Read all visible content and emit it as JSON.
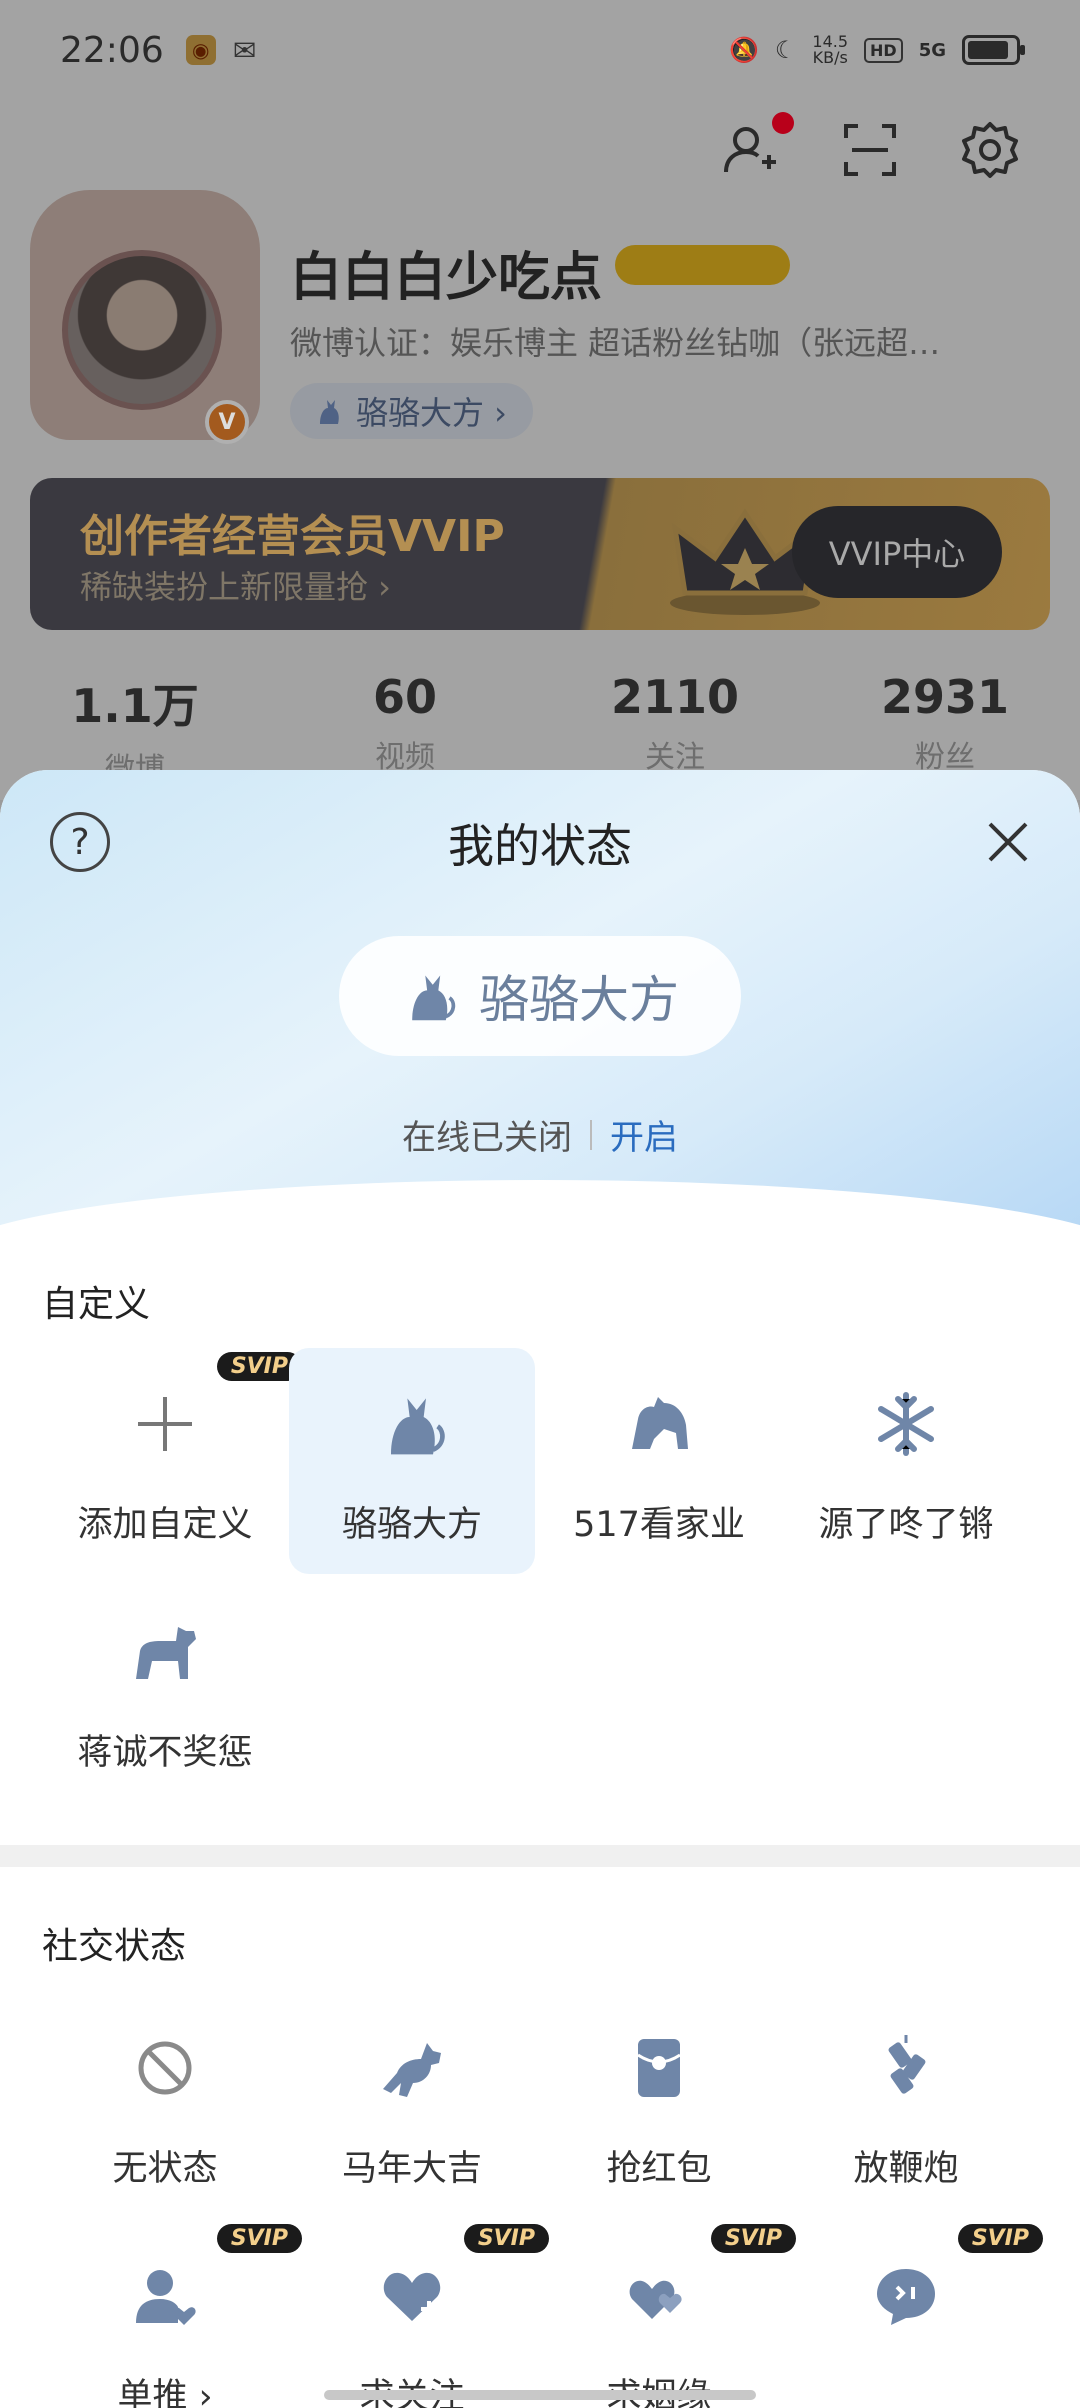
{
  "status_bar": {
    "time": "22:06",
    "net_speed": "14.5",
    "net_unit": "KB/s",
    "hd": "HD",
    "signal": "5G"
  },
  "profile": {
    "username": "白白白少吃点",
    "verification": "微博认证：娱乐博主 超话粉丝钻咖（张远超…",
    "status_chip_label": "骆骆大方 ›",
    "avatar_badge": "V"
  },
  "vvip_banner": {
    "title": "创作者经营会员VVIP",
    "subtitle": "稀缺装扮上新限量抢 ›",
    "button": "VVIP中心"
  },
  "stats": [
    {
      "value": "1.1万",
      "label": "微博"
    },
    {
      "value": "60",
      "label": "视频"
    },
    {
      "value": "2110",
      "label": "关注"
    },
    {
      "value": "2931",
      "label": "粉丝"
    }
  ],
  "sheet": {
    "help": "?",
    "title": "我的状态",
    "current_status": "骆骆大方",
    "online_text": "在线已关闭",
    "online_action": "开启"
  },
  "custom_section": {
    "title": "自定义",
    "items": [
      {
        "label": "添加自定义",
        "icon": "plus-icon",
        "badge": "SVIP"
      },
      {
        "label": "骆骆大方",
        "icon": "cat-icon",
        "selected": true
      },
      {
        "label": "517看家业",
        "icon": "horse-icon"
      },
      {
        "label": "源了咚了锵",
        "icon": "snowflake-icon"
      },
      {
        "label": "蒋诚不奖惩",
        "icon": "dog-icon"
      }
    ]
  },
  "social_section": {
    "title": "社交状态",
    "items": [
      {
        "label": "无状态",
        "icon": "no-status-icon"
      },
      {
        "label": "马年大吉",
        "icon": "leaping-horse-icon"
      },
      {
        "label": "抢红包",
        "icon": "red-envelope-icon"
      },
      {
        "label": "放鞭炮",
        "icon": "firecracker-icon"
      },
      {
        "label": "单推 ›",
        "icon": "single-fan-icon",
        "badge": "SVIP"
      },
      {
        "label": "求关注",
        "icon": "heart-plus-icon",
        "badge": "SVIP"
      },
      {
        "label": "求姻缘",
        "icon": "hearts-icon",
        "badge": "SVIP"
      },
      {
        "label": "",
        "icon": "chat-bubble-icon",
        "badge": "SVIP"
      }
    ]
  },
  "colors": {
    "accent_blue": "#2a6cbf",
    "icon_blue_gray": "#6f86a8",
    "svip_badge_bg": "#1b1b1b",
    "svip_badge_text": "#f3cf8b"
  }
}
